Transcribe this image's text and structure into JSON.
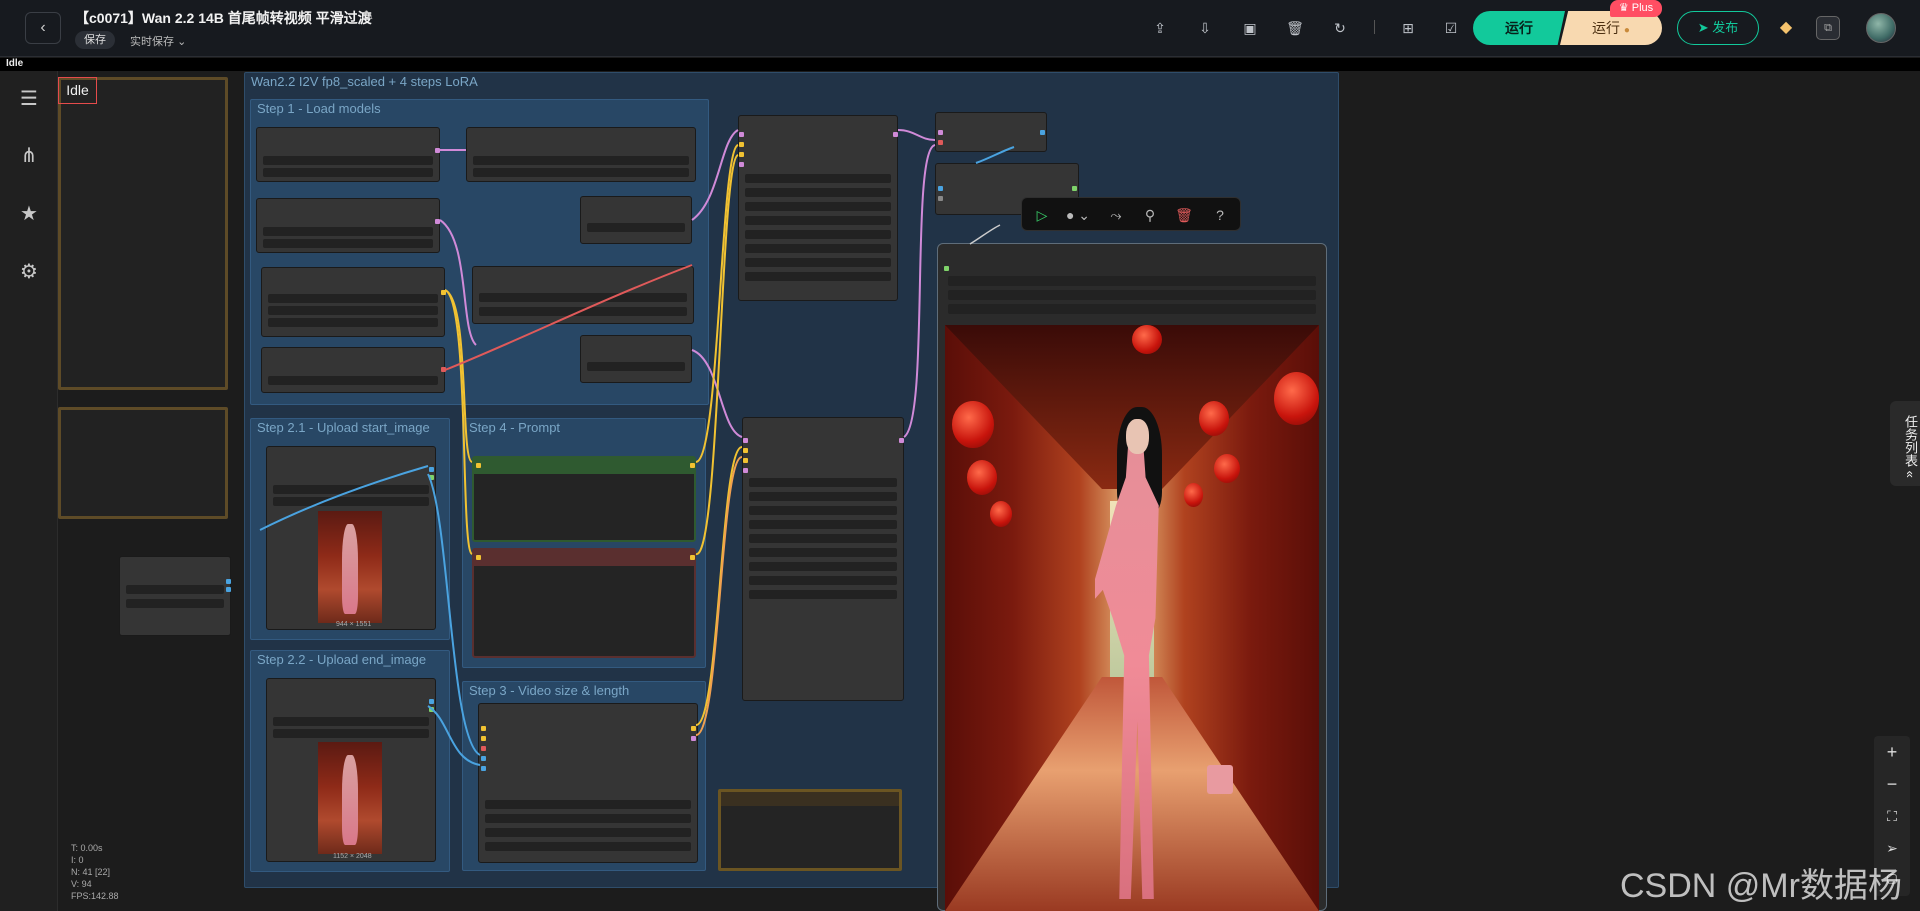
{
  "header": {
    "title": "【c0071】Wan 2.2 14B 首尾帧转视频 平滑过渡",
    "save_label": "保存",
    "autosave_label": "实时保存",
    "run_label": "运行",
    "run_plus_label": "运行",
    "plus_badge": "Plus",
    "publish_label": "发布"
  },
  "status": {
    "idle_small": "Idle",
    "idle_label": "Idle"
  },
  "groups": {
    "main": "Wan2.2 I2V fp8_scaled + 4 steps LoRA",
    "step1": "Step 1 - Load models",
    "step21": "Step 2.1 - Upload start_image",
    "step22": "Step 2.2 - Upload end_image",
    "step4": "Step 4 - Prompt",
    "step3": "Step 3 - Video size & length"
  },
  "thumbs": {
    "start_caption": "944 × 1551",
    "end_caption": "1152 × 2048"
  },
  "task_tab": "任务列表",
  "stats": "T: 0.00s\nI: 0\nN: 41 [22]\nV: 94\nFPS:142.88",
  "watermark": "CSDN @Mr数据杨",
  "colors": {
    "accent": "#12c99b",
    "plus": "#f8d9b0",
    "badge": "#ff4e63",
    "group_blue": "#2c4a66",
    "group_brown": "#5a4a2a"
  }
}
